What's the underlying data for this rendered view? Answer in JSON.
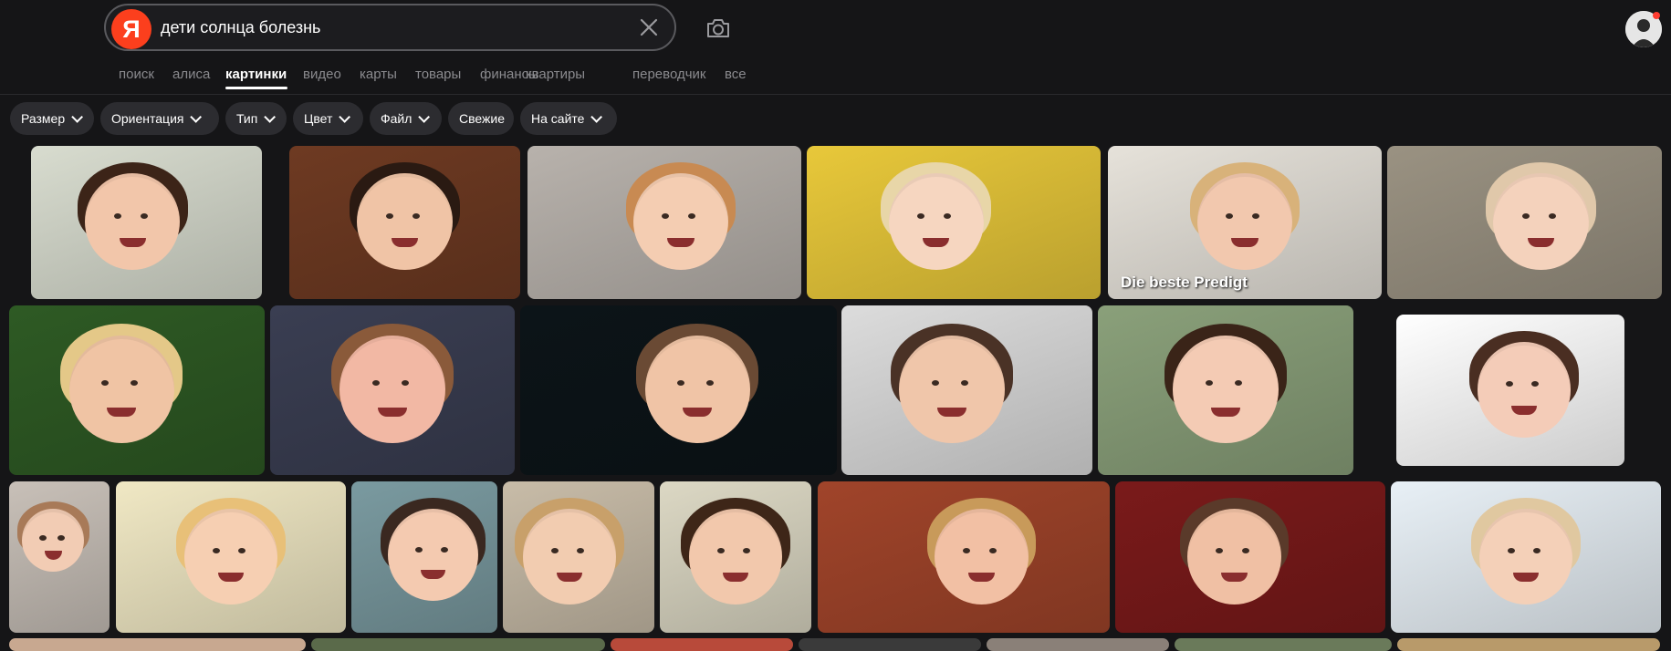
{
  "search": {
    "logo_letter": "Я",
    "query": "дети солнца болезнь"
  },
  "nav": {
    "items": [
      "поиск",
      "алиса",
      "картинки",
      "видео",
      "карты",
      "товары",
      "финансы",
      "квартиры",
      "переводчик",
      "все"
    ],
    "active": "картинки"
  },
  "filters": {
    "chips": [
      {
        "label": "Размер",
        "dropdown": true
      },
      {
        "label": "Ориентация",
        "dropdown": true
      },
      {
        "label": "Тип",
        "dropdown": true
      },
      {
        "label": "Цвет",
        "dropdown": true
      },
      {
        "label": "Файл",
        "dropdown": true
      },
      {
        "label": "Свежие",
        "dropdown": false
      },
      {
        "label": "На сайте",
        "dropdown": true
      }
    ]
  },
  "results": {
    "caption_text": "Die beste Predigt"
  },
  "colors": {
    "brand": "#fc3f1d",
    "background": "#151517",
    "chip": "#2c2c30",
    "nav_inactive": "#8a8a8e"
  }
}
